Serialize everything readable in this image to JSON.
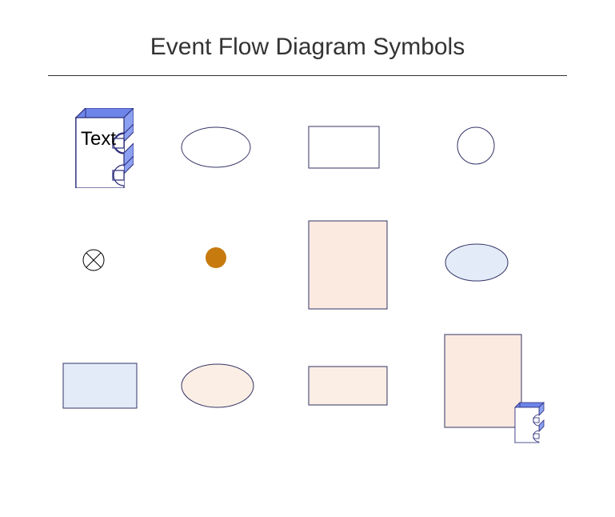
{
  "title": "Event Flow Diagram Symbols",
  "shapes": {
    "e3d_label": "Text",
    "colors": {
      "blue_side": "#6d85e8",
      "blue_side_light": "#8ba0f0",
      "stroke": "#2a2a7a",
      "light_blue": "#e3ebf8",
      "light_pink": "#faeae0",
      "light_peach": "#fbeee4",
      "orange": "#c77a0e",
      "navy_stroke": "#333366"
    }
  }
}
